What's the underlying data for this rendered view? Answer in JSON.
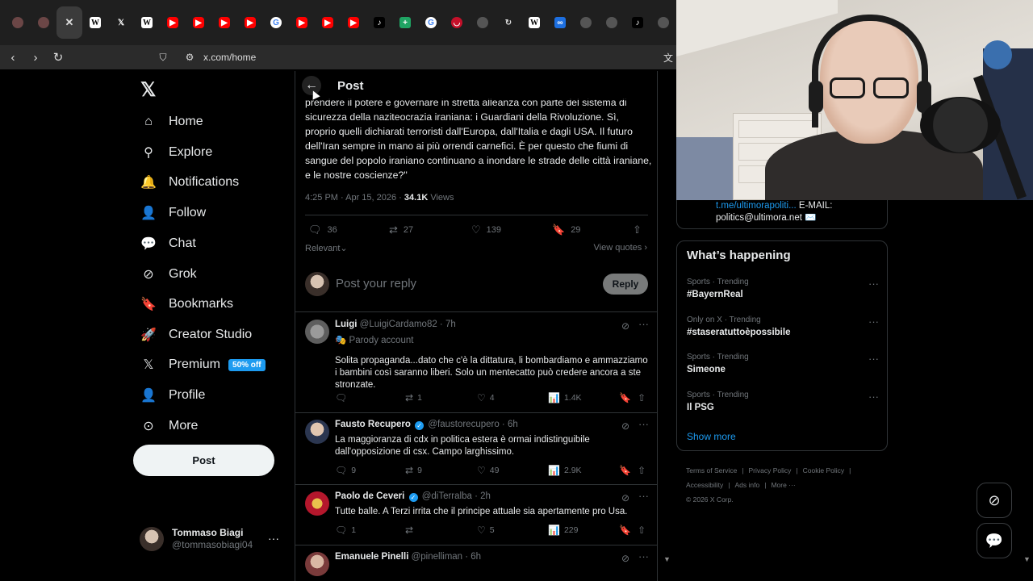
{
  "browser": {
    "tabs": [
      {
        "icon": "avatar-favicon",
        "cls": "av",
        "glyph": ""
      },
      {
        "icon": "avatar-favicon",
        "cls": "av",
        "glyph": ""
      },
      {
        "icon": "close-icon",
        "cls": "cl",
        "glyph": "✕",
        "active": true
      },
      {
        "icon": "wikipedia-favicon",
        "cls": "w",
        "glyph": "W"
      },
      {
        "icon": "x-favicon",
        "cls": "x",
        "glyph": "𝕏"
      },
      {
        "icon": "wikipedia-favicon",
        "cls": "w",
        "glyph": "W"
      },
      {
        "icon": "youtube-favicon",
        "cls": "yt",
        "glyph": "▶"
      },
      {
        "icon": "youtube-favicon",
        "cls": "yt",
        "glyph": "▶"
      },
      {
        "icon": "youtube-favicon",
        "cls": "yt",
        "glyph": "▶"
      },
      {
        "icon": "youtube-favicon",
        "cls": "yt",
        "glyph": "▶"
      },
      {
        "icon": "google-favicon",
        "cls": "g",
        "glyph": "G"
      },
      {
        "icon": "youtube-favicon",
        "cls": "yt",
        "glyph": "▶"
      },
      {
        "icon": "youtube-favicon",
        "cls": "yt",
        "glyph": "▶"
      },
      {
        "icon": "youtube-favicon",
        "cls": "yt",
        "glyph": "▶"
      },
      {
        "icon": "tiktok-favicon",
        "cls": "tt",
        "glyph": "♪"
      },
      {
        "icon": "sheets-favicon",
        "cls": "sh",
        "glyph": "+"
      },
      {
        "icon": "google-favicon",
        "cls": "g",
        "glyph": "G"
      },
      {
        "icon": "red-favicon",
        "cls": "red",
        "glyph": "◡"
      },
      {
        "icon": "globe-favicon",
        "cls": "gl",
        "glyph": ""
      },
      {
        "icon": "refresh-favicon",
        "cls": "ref",
        "glyph": "↻"
      },
      {
        "icon": "wikipedia-favicon",
        "cls": "w",
        "glyph": "W"
      },
      {
        "icon": "link-favicon",
        "cls": "blue",
        "glyph": "∞"
      },
      {
        "icon": "globe-favicon",
        "cls": "gl",
        "glyph": ""
      },
      {
        "icon": "globe-favicon",
        "cls": "gl",
        "glyph": ""
      },
      {
        "icon": "tiktok-favicon",
        "cls": "tt",
        "glyph": "♪"
      },
      {
        "icon": "globe-favicon",
        "cls": "gl",
        "glyph": ""
      }
    ],
    "url": "x.com/home"
  },
  "nav": {
    "items": [
      {
        "label": "Home",
        "icon": "home-icon",
        "glyph": "⌂"
      },
      {
        "label": "Explore",
        "icon": "search-icon",
        "glyph": "⚲"
      },
      {
        "label": "Notifications",
        "icon": "bell-icon",
        "glyph": "🔔"
      },
      {
        "label": "Follow",
        "icon": "follow-icon",
        "glyph": "👤"
      },
      {
        "label": "Chat",
        "icon": "chat-icon",
        "glyph": "💬"
      },
      {
        "label": "Grok",
        "icon": "grok-icon",
        "glyph": "⊘"
      },
      {
        "label": "Bookmarks",
        "icon": "bookmark-icon",
        "glyph": "🔖"
      },
      {
        "label": "Creator Studio",
        "icon": "rocket-icon",
        "glyph": "🚀"
      },
      {
        "label": "Premium",
        "icon": "x-premium-icon",
        "glyph": "𝕏",
        "badge": "50% off"
      },
      {
        "label": "Profile",
        "icon": "person-icon",
        "glyph": "👤"
      },
      {
        "label": "More",
        "icon": "more-circle-icon",
        "glyph": "⊙"
      }
    ],
    "post_label": "Post",
    "account": {
      "name": "Tommaso Biagi",
      "handle": "@tommasobiagi04"
    }
  },
  "post": {
    "header_title": "Post",
    "text": "prendere il potere e governare in stretta alleanza con parte del sistema di sicurezza della naziteocrazia iraniana: i Guardiani della Rivoluzione. Sì, proprio quelli dichiarati terroristi dall'Europa, dall'Italia e dagli USA. Il futuro dell'Iran sempre in mano ai più orrendi carnefici. È per questo che fiumi di sangue del popolo iraniano continuano a inondare le strade delle città iraniane, e le nostre coscienze?\"",
    "time": "4:25 PM · Apr 15, 2026 · ",
    "views_count": "34.1K",
    "views_label": " Views",
    "replies": "36",
    "reposts": "27",
    "likes": "139",
    "bookmarks": "29",
    "sort": "Relevant",
    "view_quotes": "View quotes",
    "reply_placeholder": "Post your reply",
    "reply_button": "Reply"
  },
  "replies": [
    {
      "name": "Luigi",
      "handle": "@LuigiCardamo82 · 7h",
      "verified": false,
      "parody": "Parody account",
      "text": "Solita propaganda...dato che c'è la dittatura, li bombardiamo e ammazziamo i bambini così saranno liberi. Solo un mentecatto può credere ancora a ste stronzate.",
      "reply": "",
      "repost": "1",
      "like": "4",
      "views": "1.4K"
    },
    {
      "name": "Fausto Recupero",
      "handle": "@faustorecupero · 6h",
      "verified": true,
      "parody": "",
      "text": "La maggioranza di cdx in politica estera è ormai indistinguibile dall'opposizione di csx. Campo larghissimo.",
      "reply": "9",
      "repost": "9",
      "like": "49",
      "views": "2.9K"
    },
    {
      "name": "Paolo de Ceveri",
      "handle": "@diTerralba · 2h",
      "verified": true,
      "parody": "",
      "text": "Tutte balle. A Terzi irrita che il principe attuale sia apertamente pro Usa.",
      "reply": "1",
      "repost": "",
      "like": "5",
      "views": "229"
    },
    {
      "name": "Emanuele Pinelli",
      "handle": "@pinelliman · 6h",
      "verified": false,
      "parody": "",
      "text": "",
      "reply": "",
      "repost": "",
      "like": "",
      "views": ""
    }
  ],
  "sidebar": {
    "bio_link": "t.me/ultimorapoliti...",
    "bio_rest": " E-MAIL:",
    "bio_email": "politics@ultimora.net ✉️",
    "whats_happening": "What’s happening",
    "trends": [
      {
        "context": "Sports · Trending",
        "title": "#BayernReal"
      },
      {
        "context": "Only on X · Trending",
        "title": "#staseratuttoèpossibile"
      },
      {
        "context": "Sports · Trending",
        "title": "Simeone"
      },
      {
        "context": "Sports · Trending",
        "title": "Il PSG"
      }
    ],
    "show_more": "Show more",
    "footer": [
      "Terms of Service",
      "|",
      "Privacy Policy",
      "|",
      "Cookie Policy",
      "|",
      "Accessibility",
      "|",
      "Ads info",
      "|",
      "More ···",
      "© 2026 X Corp."
    ]
  }
}
